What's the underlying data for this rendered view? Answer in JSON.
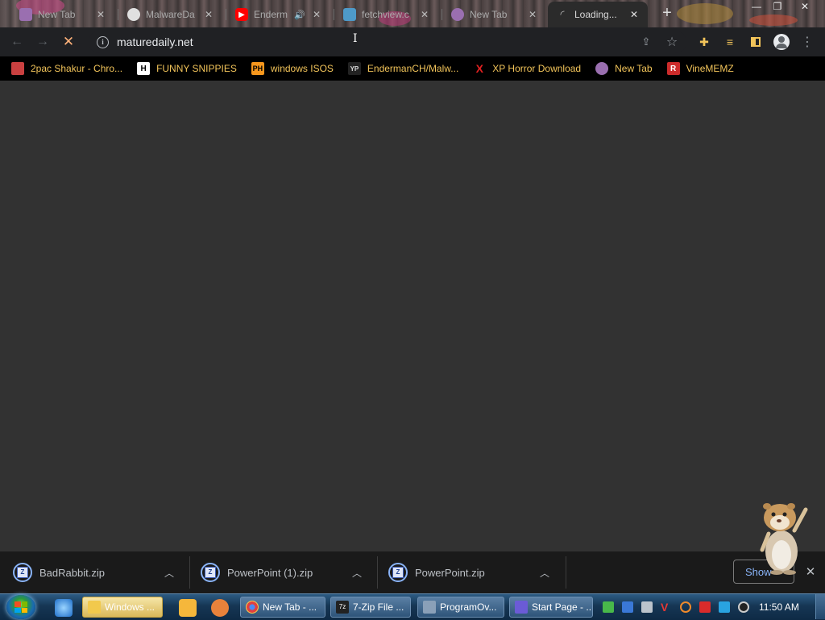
{
  "tabs": [
    {
      "title": "New Tab",
      "icon": "chrome-icon",
      "color": "#9a6fb0"
    },
    {
      "title": "MalwareDa",
      "icon": "github-icon",
      "color": "#e0e0e0"
    },
    {
      "title": "Enderm",
      "icon": "youtube-icon",
      "color": "#ff0000"
    },
    {
      "title": "fetchview.c",
      "icon": "page-icon",
      "color": "#4e9ac9"
    },
    {
      "title": "New Tab",
      "icon": "chrome-icon",
      "color": "#9a6fb0"
    },
    {
      "title": "Loading...",
      "icon": "loading-icon",
      "color": "#bbbbbb",
      "active": true
    }
  ],
  "address_bar": {
    "url": "maturedaily.net"
  },
  "bookmarks": [
    {
      "label": "2pac Shakur - Chro...",
      "icon": "bookmark-page-icon",
      "icon_text": "",
      "icon_bg": "#c94040"
    },
    {
      "label": "FUNNY SNIPPIES",
      "icon": "h-icon",
      "icon_text": "H",
      "icon_bg": "#ffffff"
    },
    {
      "label": "windows ISOS",
      "icon": "ph-icon",
      "icon_text": "PH",
      "icon_bg": "#f7971d"
    },
    {
      "label": "EndermanCH/Malw...",
      "icon": "yp-icon",
      "icon_text": "YP",
      "icon_bg": "#222222"
    },
    {
      "label": "XP Horror Download",
      "icon": "x-icon",
      "icon_text": "X",
      "icon_bg": "#000000"
    },
    {
      "label": "New Tab",
      "icon": "chrome-icon",
      "icon_text": "",
      "icon_bg": "#9a6fb0"
    },
    {
      "label": "VineMEMZ",
      "icon": "r-icon",
      "icon_text": "R",
      "icon_bg": "#cc2b2b"
    }
  ],
  "downloads": [
    {
      "name": "BadRabbit.zip"
    },
    {
      "name": "PowerPoint (1).zip"
    },
    {
      "name": "PowerPoint.zip"
    }
  ],
  "download_shelf": {
    "show_all_label": "Show"
  },
  "taskbar": {
    "tasks": [
      {
        "label": "Windows ...",
        "icon": "folder-icon",
        "icon_color": "#f2c94c",
        "highlight": true
      },
      {
        "label": "New Tab - ...",
        "icon": "chrome-icon",
        "icon_color": "#e04040"
      },
      {
        "label": "7-Zip File ...",
        "icon": "7zip-icon",
        "icon_color": "#222222"
      },
      {
        "label": "ProgramOv...",
        "icon": "program-icon",
        "icon_color": "#8aa0b8"
      },
      {
        "label": "Start Page - ...",
        "icon": "start-page-icon",
        "icon_color": "#6b5bd6"
      }
    ],
    "clock": "11:50 AM"
  }
}
